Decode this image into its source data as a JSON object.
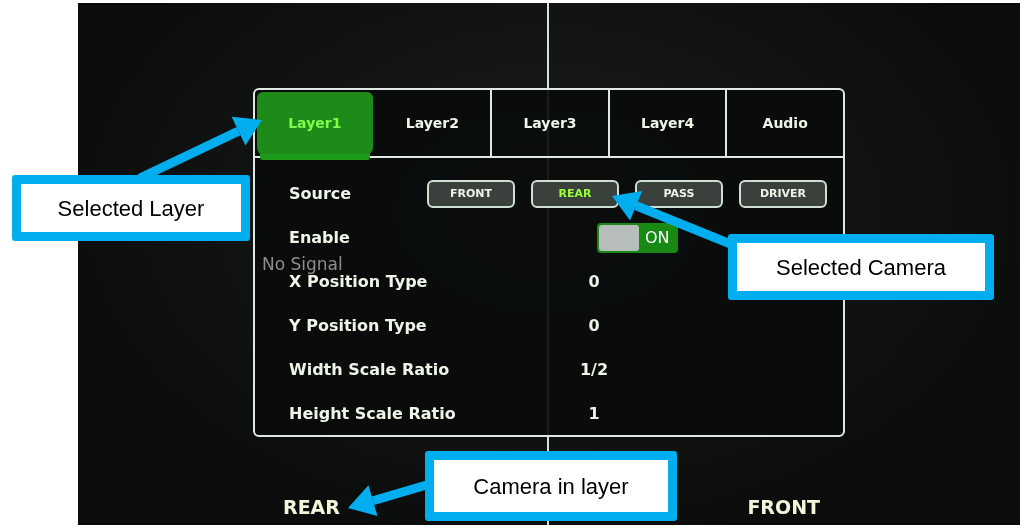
{
  "screen": {
    "tabs": [
      {
        "label": "Layer1",
        "selected": true
      },
      {
        "label": "Layer2",
        "selected": false
      },
      {
        "label": "Layer3",
        "selected": false
      },
      {
        "label": "Layer4",
        "selected": false
      },
      {
        "label": "Audio",
        "selected": false
      }
    ],
    "source": {
      "label": "Source",
      "options": [
        {
          "label": "FRONT",
          "selected": false
        },
        {
          "label": "REAR",
          "selected": true
        },
        {
          "label": "PASS",
          "selected": false
        },
        {
          "label": "DRIVER",
          "selected": false
        }
      ]
    },
    "enable": {
      "label": "Enable",
      "on": true,
      "text": "ON"
    },
    "settings": [
      {
        "label": "X Position Type",
        "value": "0"
      },
      {
        "label": "Y Position Type",
        "value": "0"
      },
      {
        "label": "Width Scale Ratio",
        "value": "1/2"
      },
      {
        "label": "Height Scale Ratio",
        "value": "1"
      }
    ],
    "no_signal": "No Signal",
    "camera_labels": [
      "REAR",
      "FRONT"
    ]
  },
  "callouts": [
    {
      "text": "Selected Layer"
    },
    {
      "text": "Selected Camera"
    },
    {
      "text": "Camera in layer"
    }
  ]
}
